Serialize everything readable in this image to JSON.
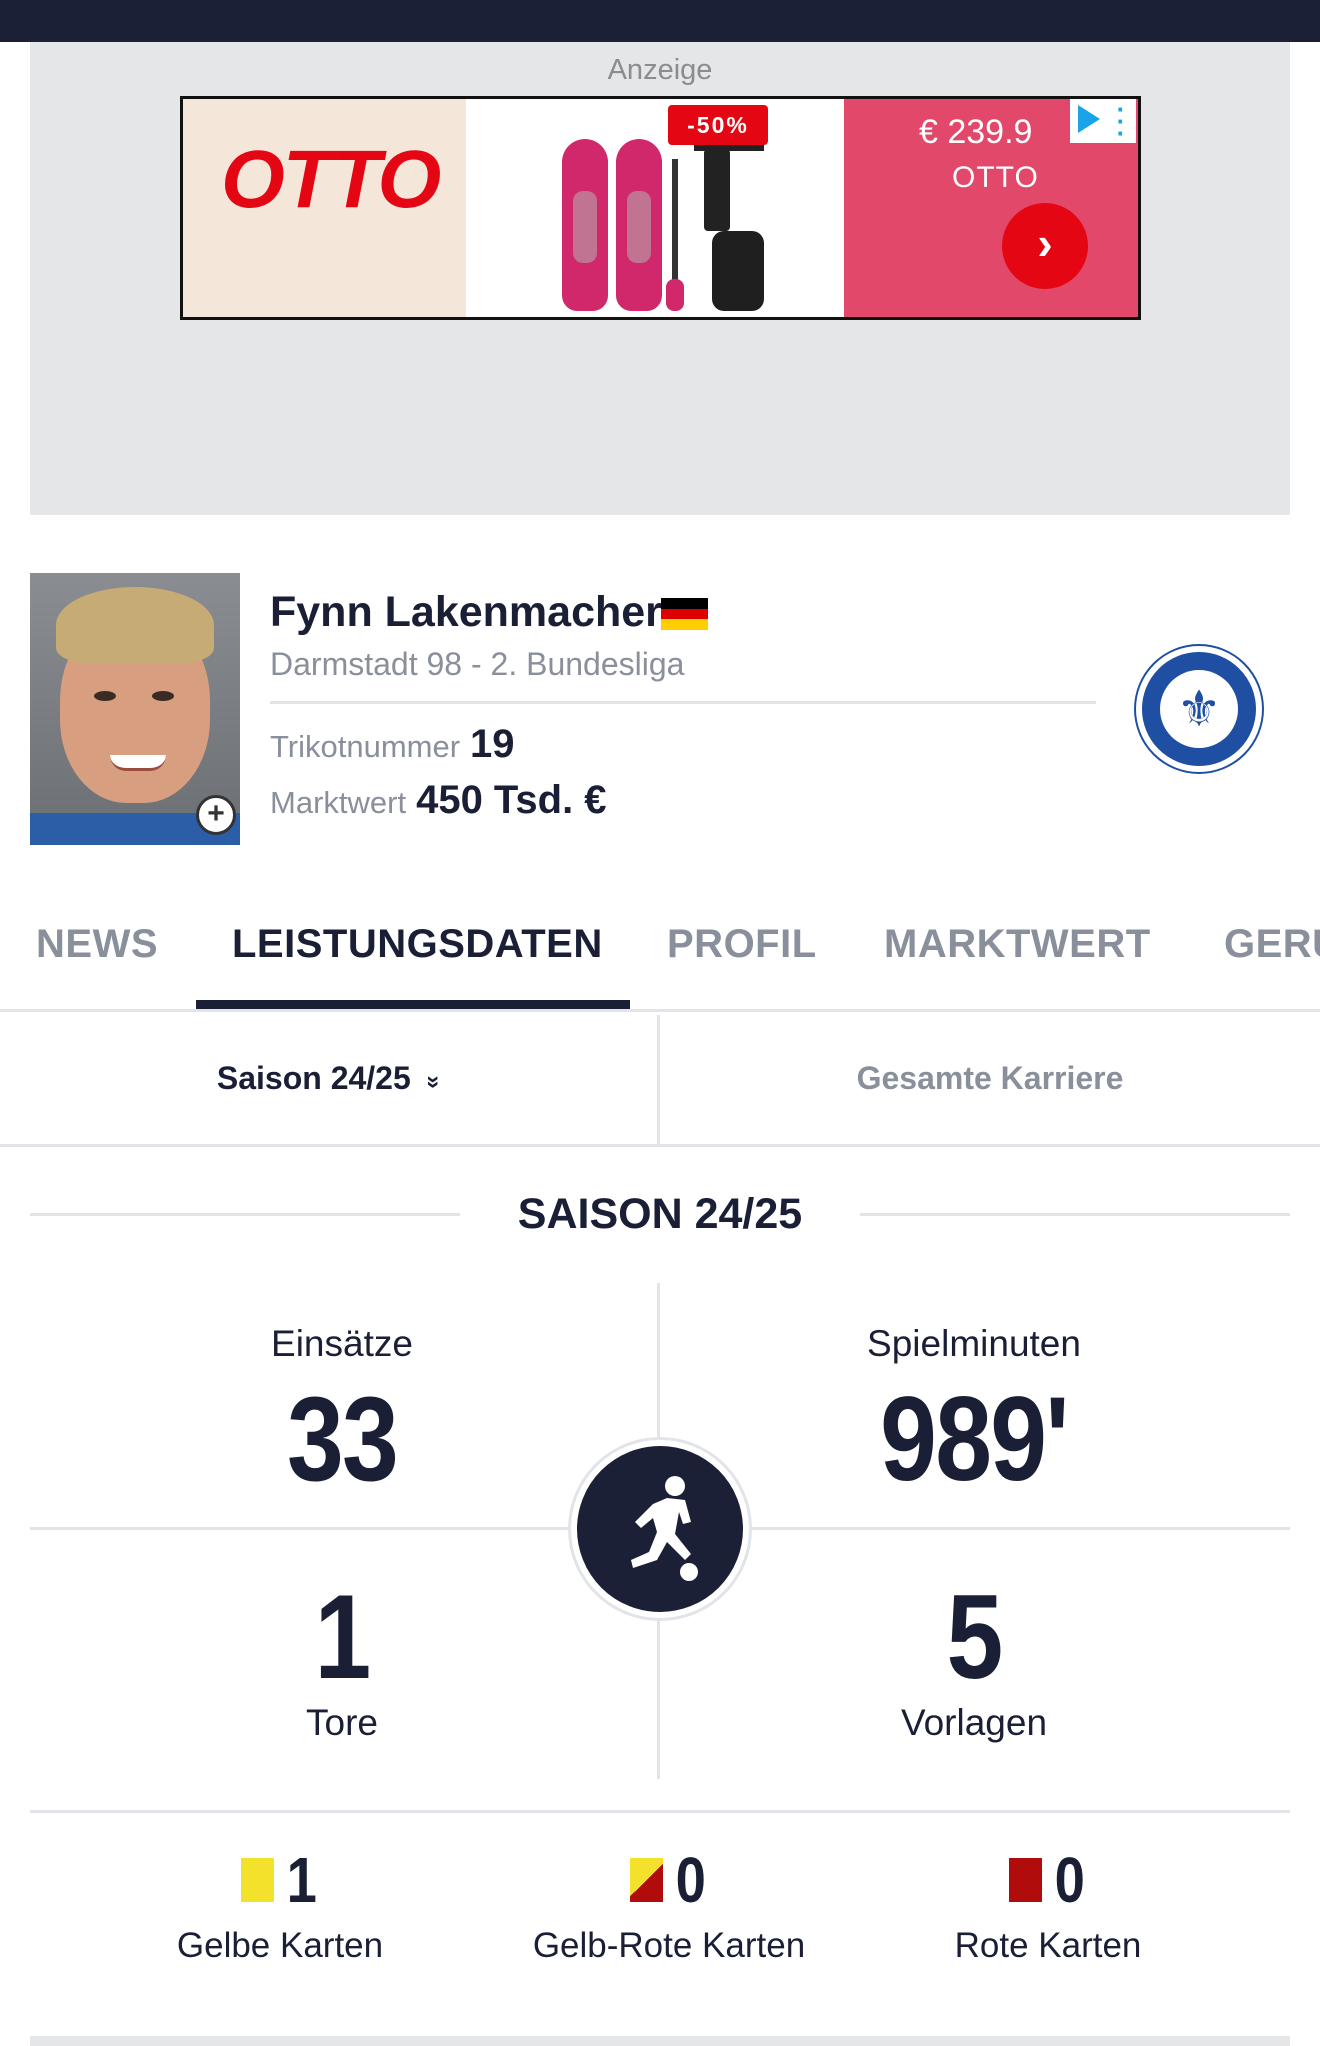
{
  "ad": {
    "label": "Anzeige",
    "logo_text": "OTTO",
    "discount": "-50%",
    "price": "€ 239.9",
    "brand": "OTTO",
    "cta_arrow": "›"
  },
  "player": {
    "name": "Fynn Lakenmacher",
    "nationality_flag": "germany-flag",
    "club_league": "Darmstadt 98 - 2. Bundesliga",
    "jersey_label": "Trikotnummer",
    "jersey_number": "19",
    "market_value_label": "Marktwert",
    "market_value": "450 Tsd. €",
    "zoom_icon": "+"
  },
  "club_logo": {
    "glyph": "⚜"
  },
  "tabs": [
    {
      "label": "NEWS"
    },
    {
      "label": "LEISTUNGSDATEN",
      "active": true
    },
    {
      "label": "PROFIL"
    },
    {
      "label": "MARKTWERT"
    },
    {
      "label": "GERÜ"
    }
  ],
  "season_filter": {
    "selected": "Saison 24/25",
    "chevron": "»",
    "career": "Gesamte Karriere"
  },
  "stats": {
    "title": "SAISON 24/25",
    "appearances_label": "Einsätze",
    "appearances": "33",
    "minutes_label": "Spielminuten",
    "minutes": "989'",
    "goals": "1",
    "goals_label": "Tore",
    "assists": "5",
    "assists_label": "Vorlagen"
  },
  "cards": {
    "yellow_count": "1",
    "yellow_label": "Gelbe Karten",
    "yellowred_count": "0",
    "yellowred_label": "Gelb-Rote Karten",
    "red_count": "0",
    "red_label": "Rote Karten"
  },
  "colors": {
    "navy": "#1b2036",
    "yellow_card": "#f3e12c",
    "red_card": "#b00c0c",
    "otto_red": "#e40613",
    "ad_pink": "#e14869"
  }
}
